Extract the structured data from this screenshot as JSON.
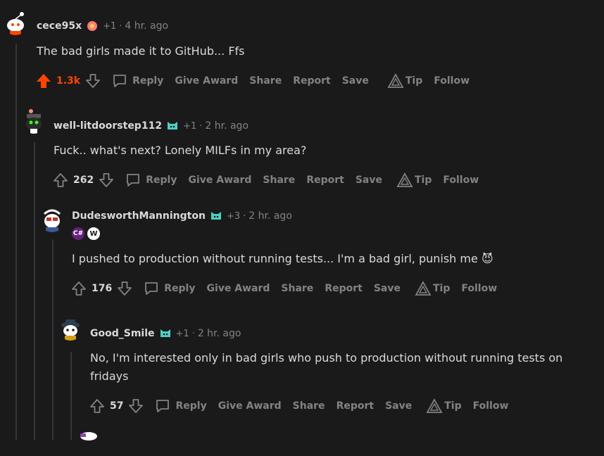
{
  "comments": [
    {
      "username": "cece95x",
      "karma": "+1",
      "time": "4 hr. ago",
      "body": "The bad girls made it to GitHub... Ffs",
      "score": "1.3k",
      "upvoted": true
    },
    {
      "username": "well-litdoorstep112",
      "karma": "+1",
      "time": "2 hr. ago",
      "body": "Fuck.. what's next? Lonely MILFs in my area?",
      "score": "262",
      "upvoted": false
    },
    {
      "username": "DudesworthMannington",
      "karma": "+3",
      "time": "2 hr. ago",
      "body": "I pushed to production without running tests... I'm a bad girl, punish me",
      "emoji": "😈",
      "score": "176",
      "upvoted": false,
      "badges": [
        "C#",
        "W"
      ]
    },
    {
      "username": "Good_Smile",
      "karma": "+1",
      "time": "2 hr. ago",
      "body_line1": "No, I'm interested only in bad girls who push to production without running tests on",
      "body_line2": "fridays",
      "score": "57",
      "upvoted": false
    }
  ],
  "actions": {
    "reply": "Reply",
    "give_award": "Give Award",
    "share": "Share",
    "report": "Report",
    "save": "Save",
    "tip": "Tip",
    "follow": "Follow"
  },
  "separator": "·",
  "colors": {
    "background": "#1a1a1b",
    "text": "#d7dadc",
    "muted": "#818384",
    "upvote": "#ff4500",
    "thread_line": "#343536"
  }
}
